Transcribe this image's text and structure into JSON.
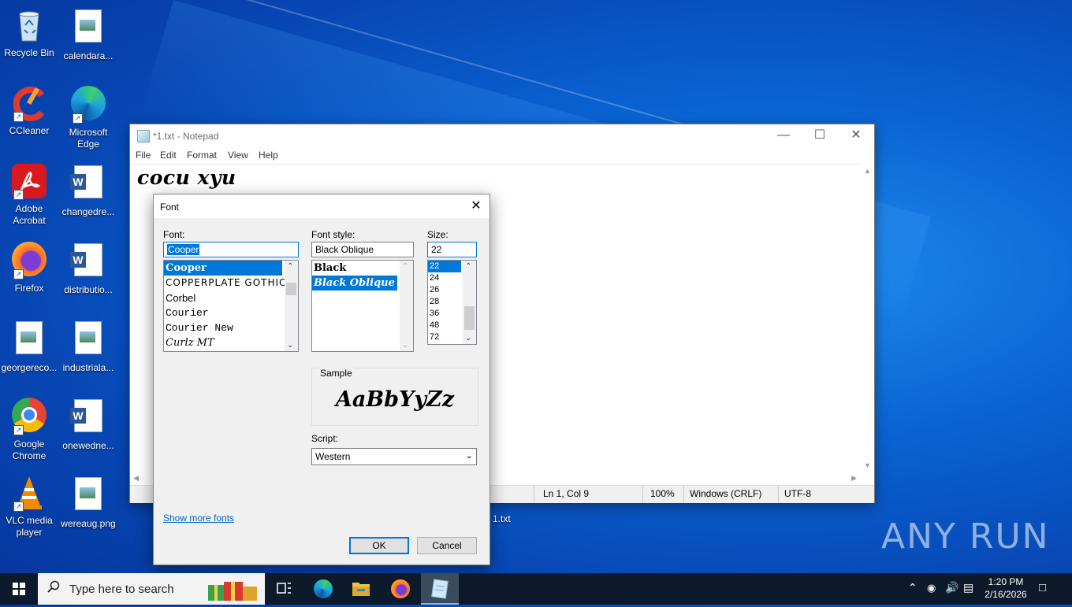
{
  "desktop": {
    "icons": [
      {
        "label": "Recycle Bin",
        "icon": "recycle-bin-icon"
      },
      {
        "label": "calendara...",
        "icon": "image-file-icon"
      },
      {
        "label": "CCleaner",
        "icon": "ccleaner-icon"
      },
      {
        "label": "Microsoft Edge",
        "icon": "edge-icon"
      },
      {
        "label": "Adobe Acrobat",
        "icon": "acrobat-icon"
      },
      {
        "label": "changedre...",
        "icon": "word-doc-icon"
      },
      {
        "label": "Firefox",
        "icon": "firefox-icon"
      },
      {
        "label": "distributio...",
        "icon": "word-doc-icon"
      },
      {
        "label": "georgereco...",
        "icon": "image-file-icon"
      },
      {
        "label": "industriala...",
        "icon": "image-file-icon"
      },
      {
        "label": "Google Chrome",
        "icon": "chrome-icon"
      },
      {
        "label": "onewedne...",
        "icon": "word-doc-icon"
      },
      {
        "label": "VLC media player",
        "icon": "vlc-icon"
      },
      {
        "label": "wereaug.png",
        "icon": "image-file-icon"
      },
      {
        "label": "1.txt",
        "icon": "text-file-icon"
      }
    ]
  },
  "notepad": {
    "title": "*1.txt - Notepad",
    "menu": [
      "File",
      "Edit",
      "Format",
      "View",
      "Help"
    ],
    "content": "cocu xyu",
    "status": {
      "position": "Ln 1, Col 9",
      "zoom": "100%",
      "line_endings": "Windows (CRLF)",
      "encoding": "UTF-8"
    }
  },
  "font_dialog": {
    "title": "Font",
    "font_label": "Font:",
    "font_value": "Cooper",
    "font_list": [
      "Cooper",
      "COPPERPLATE GOTHIC",
      "Corbel",
      "Courier",
      "Courier New",
      "Curlz MT"
    ],
    "font_selected": "Cooper",
    "style_label": "Font style:",
    "style_value": "Black Oblique",
    "style_list": [
      "Black",
      "Black Oblique"
    ],
    "style_selected": "Black Oblique",
    "size_label": "Size:",
    "size_value": "22",
    "size_list": [
      "22",
      "24",
      "26",
      "28",
      "36",
      "48",
      "72"
    ],
    "size_selected": "22",
    "sample_label": "Sample",
    "sample_text": "AaBbYyZz",
    "script_label": "Script:",
    "script_value": "Western",
    "show_more_link": "Show more fonts",
    "ok_label": "OK",
    "cancel_label": "Cancel"
  },
  "watermark": "ANY RUN",
  "taskbar": {
    "search_placeholder": "Type here to search",
    "pinned": [
      "task-view-icon",
      "edge-icon",
      "file-explorer-icon",
      "firefox-icon",
      "notepad-icon"
    ],
    "time": "1:20 PM",
    "date": "2/16/2026"
  },
  "colors": {
    "selection": "#0078d7",
    "link": "#0066cc",
    "taskbar": "#0d1a2b"
  }
}
